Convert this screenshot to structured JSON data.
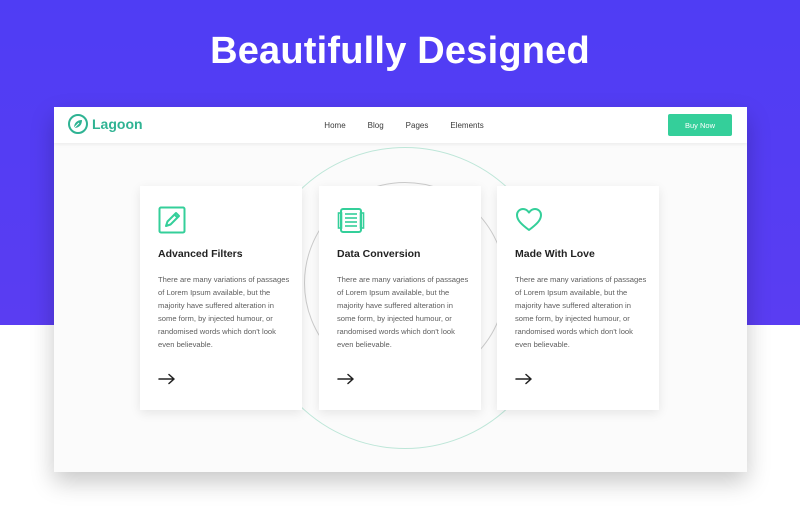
{
  "headline": "Beautifully Designed",
  "navbar": {
    "logo_text": "Lagoon",
    "links": [
      "Home",
      "Blog",
      "Pages",
      "Elements"
    ],
    "cta_label": "Buy Now"
  },
  "colors": {
    "hero_background": "#5140f4",
    "accent": "#34cf9a",
    "logo_green": "#2fb393"
  },
  "cards": [
    {
      "icon": "pencil-square-icon",
      "title": "Advanced Filters",
      "description": "There are many variations of passages of Lorem Ipsum available, but the majority have suffered alteration in some form, by injected humour, or randomised words which don't look even believable."
    },
    {
      "icon": "document-stack-icon",
      "title": "Data Conversion",
      "description": "There are many variations of passages of Lorem Ipsum available, but the majority have suffered alteration in some form, by injected humour, or randomised words which don't look even believable."
    },
    {
      "icon": "heart-icon",
      "title": "Made With Love",
      "description": "There are many variations of passages of Lorem Ipsum available, but the majority have suffered alteration in some form, by injected humour, or randomised words which don't look even believable."
    }
  ]
}
